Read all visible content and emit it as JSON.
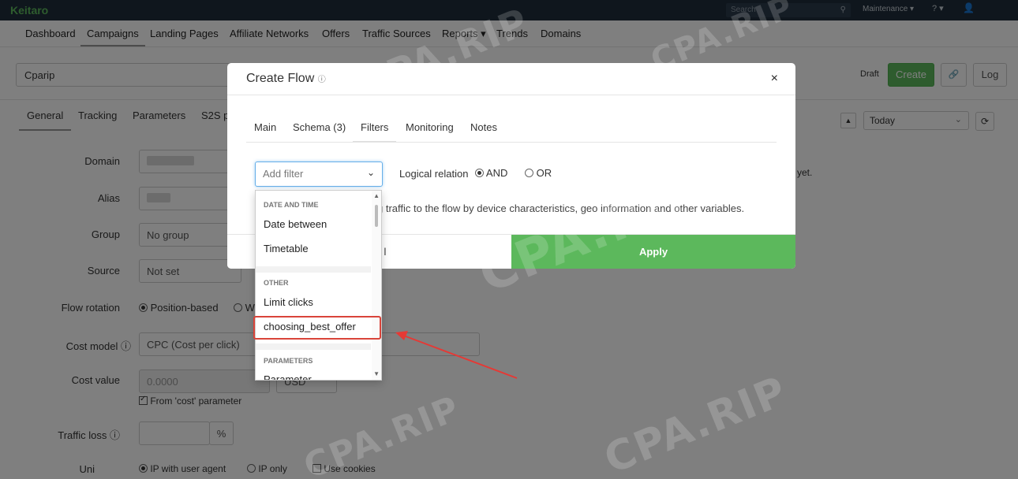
{
  "topbar": {
    "brand": "Keitaro",
    "search_placeholder": "Search",
    "maintenance": "Maintenance ▾",
    "help": "? ▾",
    "user": "👤"
  },
  "nav": {
    "items": [
      "Dashboard",
      "Campaigns",
      "Landing Pages",
      "Affiliate Networks",
      "Offers",
      "Traffic Sources",
      "Reports ▾",
      "Trends",
      "Domains"
    ],
    "active": "Campaigns"
  },
  "campaign": {
    "name": "Cparip",
    "draft_label": "Draft",
    "create_label": "Create",
    "link_label": "🔗",
    "log_label": "Log"
  },
  "subtabs": [
    "General",
    "Tracking",
    "Parameters",
    "S2S p"
  ],
  "stats": {
    "sort_icon": "▲",
    "period": "Today",
    "refresh_icon": "⟳",
    "no_data": "yet."
  },
  "form": {
    "domain_label": "Domain",
    "alias_label": "Alias",
    "group_label": "Group",
    "group_value": "No group",
    "source_label": "Source",
    "source_value": "Not set",
    "flow_rotation_label": "Flow rotation",
    "flow_rotation_option1": "Position-based",
    "flow_rotation_option2": "We",
    "cost_model_label": "Cost model ⓘ",
    "cost_model_value": "CPC (Cost per click)",
    "cost_value_label": "Cost value",
    "cost_value": "0.0000",
    "currency": "USD",
    "from_cost_label": "From 'cost' parameter",
    "traffic_loss_label": "Traffic loss ⓘ",
    "traffic_loss_unit": "%",
    "uniqueness_label": "Uni",
    "uniq_opt1": "IP with user agent",
    "uniq_opt2": "IP only",
    "uniq_opt3": "Use cookies"
  },
  "modal": {
    "title": "Create Flow",
    "info_icon": "ⓘ",
    "close": "×",
    "tabs": [
      "Main",
      "Schema (3)",
      "Filters",
      "Monitoring",
      "Notes"
    ],
    "active_tab": "Filters",
    "filter_placeholder": "Add filter",
    "logical_label": "Logical relation",
    "and_label": "AND",
    "or_label": "OR",
    "help_text": "g traffic to the flow by device characteristics, geo information and other variables.",
    "cancel_label": "l",
    "apply_label": "Apply"
  },
  "dropdown": {
    "groups": [
      {
        "title": "DATE AND TIME",
        "items": [
          "Date between",
          "Timetable"
        ]
      },
      {
        "title": "OTHER",
        "items": [
          "Limit clicks",
          "choosing_best_offer"
        ]
      },
      {
        "title": "PARAMETERS",
        "items": [
          "Parameter"
        ]
      }
    ]
  },
  "watermark": "CPA.RIP",
  "colors": {
    "topbar": "#1f2d3a",
    "accent": "#5cb85c",
    "highlight": "#d9443a"
  }
}
